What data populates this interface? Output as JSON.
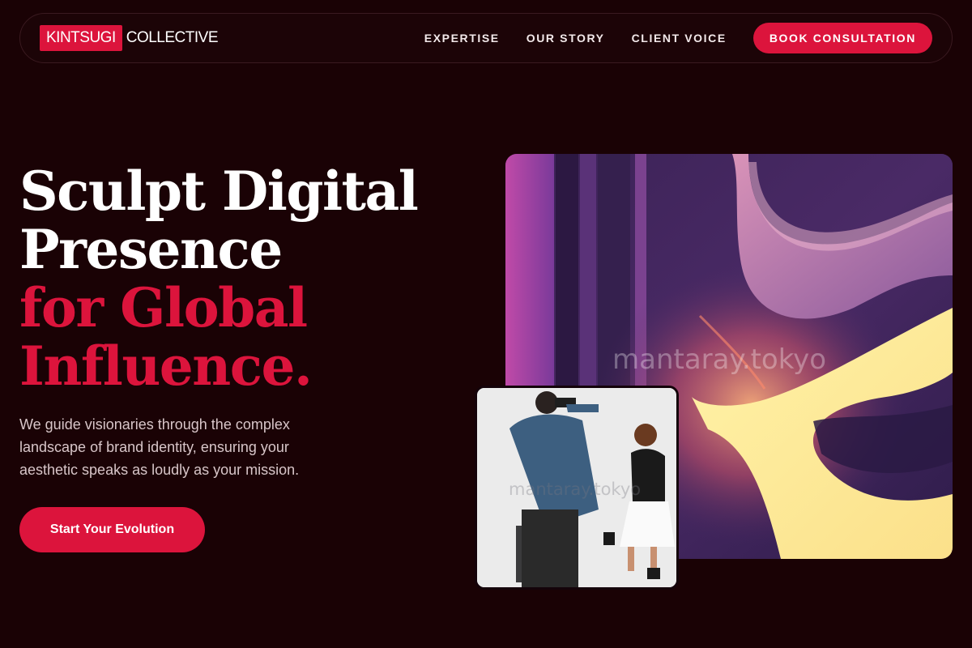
{
  "brand": {
    "logo_highlight": "KINTSUGI",
    "logo_rest": "COLLECTIVE",
    "accent_color": "#dc143c",
    "background_color": "#1a0205"
  },
  "nav": {
    "links": [
      "EXPERTISE",
      "OUR STORY",
      "CLIENT VOICE"
    ],
    "cta": "BOOK CONSULTATION"
  },
  "hero": {
    "headline_white": [
      "Sculpt Digital",
      "Presence"
    ],
    "headline_red": [
      "for Global",
      "Influence."
    ],
    "lead": "We guide visionaries through the complex landscape of brand identity, ensuring your aesthetic speaks as loudly as your mission.",
    "cta": "Start Your Evolution"
  },
  "media": {
    "watermark": "mantaray.tokyo",
    "art_image": "abstract-swirl-artwork",
    "photo_image": "photographer-shooting-woman-photo"
  }
}
